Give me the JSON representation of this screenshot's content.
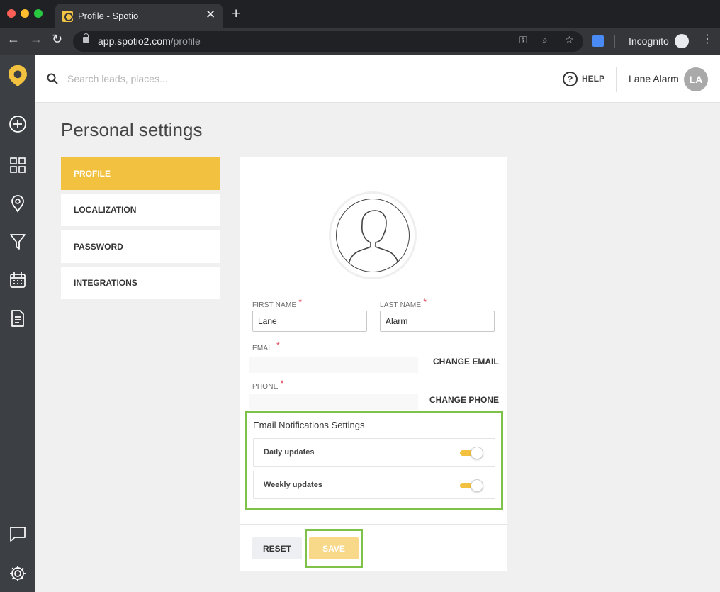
{
  "browser": {
    "tab_title": "Profile - Spotio",
    "url_host": "app.spotio2.com",
    "url_path": "/profile",
    "incognito_label": "Incognito"
  },
  "rail": {
    "icons": [
      "add-icon",
      "dashboard-icon",
      "map-pin-icon",
      "filter-icon",
      "calendar-icon",
      "document-icon",
      "chat-icon",
      "settings-icon"
    ]
  },
  "header": {
    "search_placeholder": "Search leads, places...",
    "help_label": "HELP",
    "user_name": "Lane Alarm",
    "user_initials": "LA"
  },
  "page": {
    "title": "Personal settings"
  },
  "settings_nav": {
    "items": [
      {
        "label": "PROFILE",
        "active": true
      },
      {
        "label": "LOCALIZATION",
        "active": false
      },
      {
        "label": "PASSWORD",
        "active": false
      },
      {
        "label": "INTEGRATIONS",
        "active": false
      }
    ]
  },
  "profile": {
    "first_name_label": "FIRST NAME",
    "first_name_value": "Lane",
    "last_name_label": "LAST NAME",
    "last_name_value": "Alarm",
    "required_mark": "*",
    "email_label": "EMAIL",
    "change_email_label": "CHANGE EMAIL",
    "phone_label": "PHONE",
    "change_phone_label": "CHANGE PHONE"
  },
  "notifications": {
    "title": "Email Notifications Settings",
    "items": [
      {
        "label": "Daily updates",
        "enabled": true
      },
      {
        "label": "Weekly updates",
        "enabled": true
      }
    ]
  },
  "actions": {
    "reset_label": "RESET",
    "save_label": "SAVE"
  },
  "colors": {
    "accent": "#f2c13f",
    "highlight_outline": "#7fc24a",
    "rail_bg": "#3c3f44"
  }
}
